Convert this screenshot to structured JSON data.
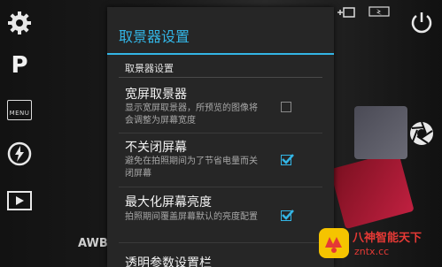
{
  "dialog": {
    "title": "取景器设置",
    "section_header": "取景器设置",
    "items": [
      {
        "title": "宽屏取景器",
        "summary": "显示宽屏取景器，所预览的图像将会调整为屏幕宽度",
        "checked": false
      },
      {
        "title": "不关闭屏幕",
        "summary": "避免在拍照期间为了节省电量而关闭屏幕",
        "checked": true
      },
      {
        "title": "最大化屏幕亮度",
        "summary": "拍照期间覆盖屏幕默认的亮度配置",
        "checked": true
      },
      {
        "title": "透明参数设置栏",
        "summary": "",
        "checked": false
      }
    ]
  },
  "left_toolbar": {
    "mode_label": "P",
    "menu_label": "MENU"
  },
  "awb_label": "AWB",
  "watermark": {
    "line1": "八神智能天下",
    "line2": "zntx.cc"
  },
  "colors": {
    "accent": "#33b5e5",
    "dialog_bg": "#262626",
    "watermark": "#e53935"
  }
}
